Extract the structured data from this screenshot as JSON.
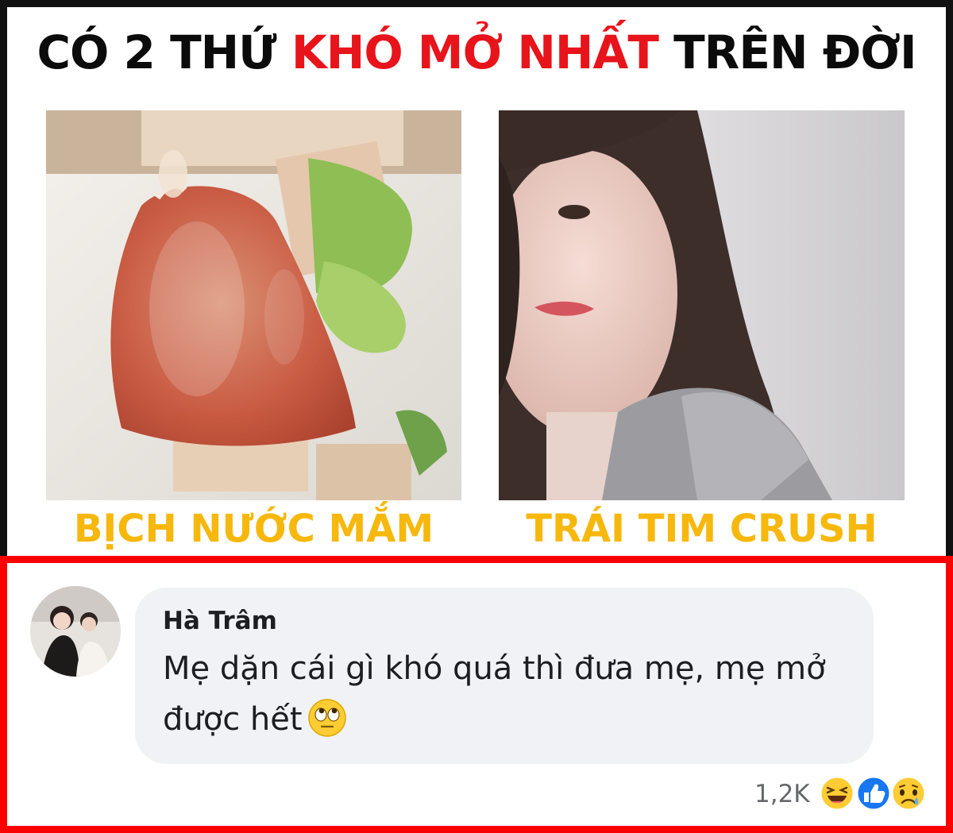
{
  "headline": {
    "part1": "CÓ 2 THỨ ",
    "part2": "KHÓ MỞ NHẤT",
    "part3": " TRÊN ĐỜI"
  },
  "captions": {
    "left": "BỊCH NƯỚC MẮM",
    "right": "TRÁI TIM CRUSH"
  },
  "comment": {
    "author": "Hà Trâm",
    "text": "Mẹ dặn cái gì khó quá thì đưa mẹ, mẹ mở được hết",
    "inline_emoji": "face-with-rolling-eyes-emoji",
    "reaction_count": "1,2K",
    "reactions": [
      "haha-reaction-icon",
      "like-reaction-icon",
      "sad-reaction-icon"
    ]
  },
  "colors": {
    "headline_red": "#e8141b",
    "caption_yellow": "#f7b80d",
    "comment_frame": "#ff0000",
    "bubble": "#f0f2f5"
  }
}
